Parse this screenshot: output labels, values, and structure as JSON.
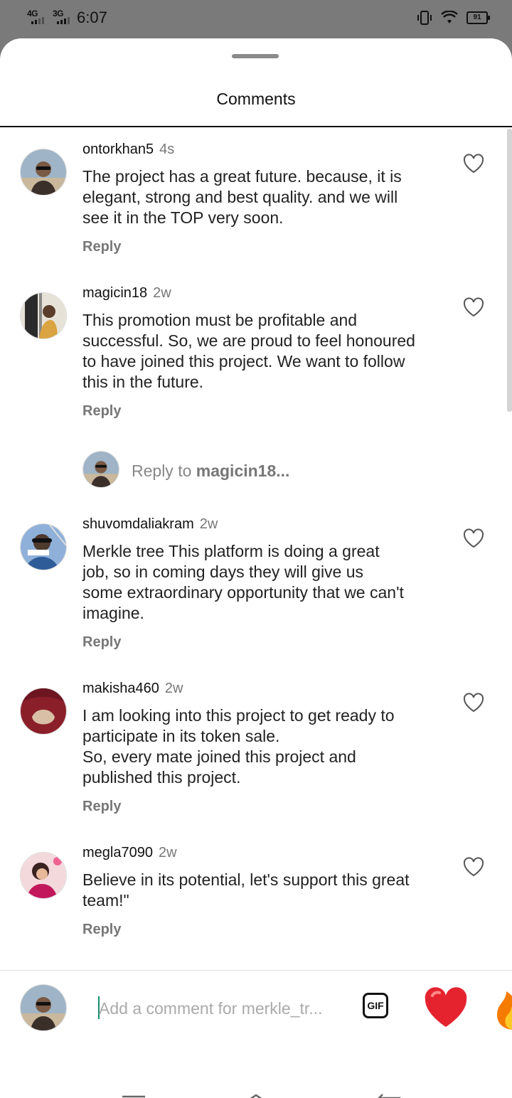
{
  "status_bar": {
    "network1": "4G",
    "network2": "3G",
    "time": "6:07",
    "battery": "91",
    "icons": [
      "vibrate-icon",
      "wifi-icon",
      "battery-icon"
    ]
  },
  "sheet": {
    "title": "Comments"
  },
  "comments": [
    {
      "username": "ontorkhan5",
      "time": "4s",
      "text": "The project has a great future. because, it is\nelegant, strong and best quality. and we will\nsee it in the TOP very soon.",
      "reply_label": "Reply"
    },
    {
      "username": "magicin18",
      "time": "2w",
      "text": "This promotion must be profitable and\nsuccessful. So, we are proud to feel honoured\nto have joined this project. We want to follow\nthis in the future.",
      "reply_label": "Reply"
    },
    {
      "username": "shuvomdaliakram",
      "time": "2w",
      "text": "Merkle tree This platform is doing a great\njob, so in coming days they will give us\nsome extraordinary opportunity that we can't\nimagine.",
      "reply_label": "Reply"
    },
    {
      "username": "makisha460",
      "time": "2w",
      "text": "I am looking into this project to get ready to\nparticipate in its token sale.\nSo, every mate joined this project and\npublished this project.",
      "reply_label": "Reply"
    },
    {
      "username": "megla7090",
      "time": "2w",
      "text": "Believe in its potential, let's support this great\nteam!\"",
      "reply_label": "Reply"
    }
  ],
  "reply_to": {
    "prefix": "Reply to ",
    "username": "magicin18..."
  },
  "composer": {
    "placeholder": "Add a comment for merkle_tr...",
    "gif_label": "GIF",
    "emojis": [
      "red-heart-emoji",
      "fire-emoji"
    ]
  },
  "nav": [
    "menu-icon",
    "home-icon",
    "back-icon"
  ]
}
